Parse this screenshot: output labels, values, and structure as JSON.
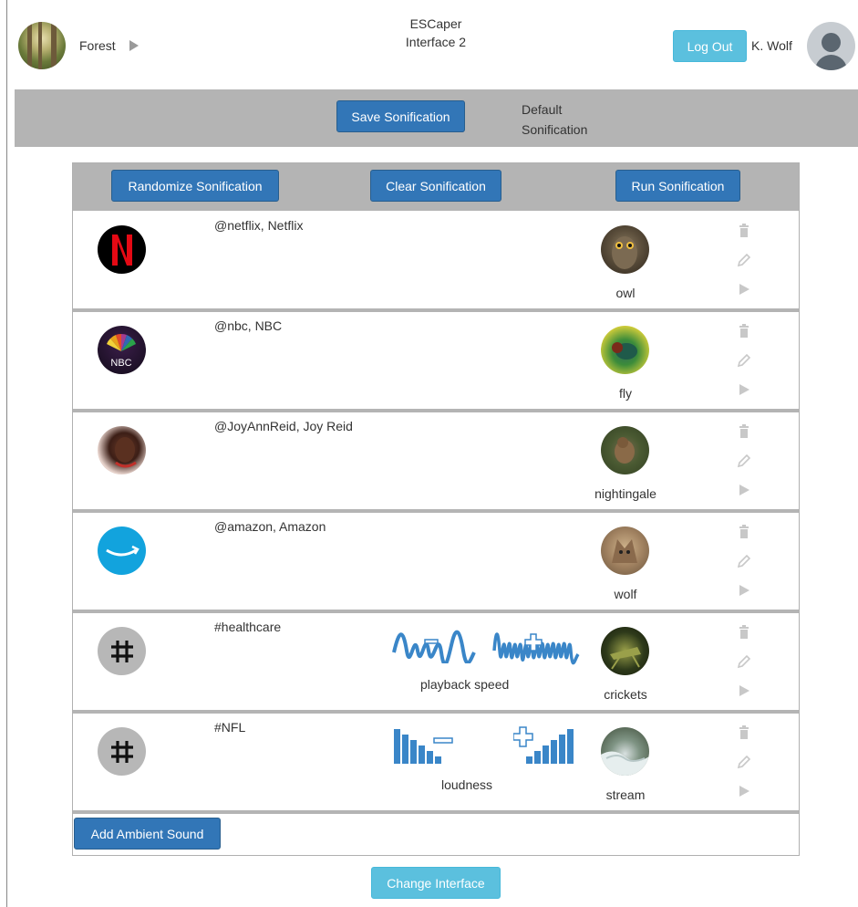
{
  "header": {
    "environment_name": "Forest",
    "app_title": "ESCaper",
    "app_subtitle": "Interface 2",
    "logout_label": "Log Out",
    "user_name": "K. Wolf"
  },
  "savebar": {
    "save_label": "Save Sonification",
    "current_line1": "Default",
    "current_line2": "Sonification"
  },
  "toolbar": {
    "randomize_label": "Randomize Sonification",
    "clear_label": "Clear Sonification",
    "run_label": "Run Sonification"
  },
  "rows": [
    {
      "source": "@netflix, Netflix",
      "source_icon": "netflix-logo",
      "sound": "owl"
    },
    {
      "source": "@nbc, NBC",
      "source_icon": "nbc-logo",
      "source_icon_text": "NBC",
      "sound": "fly"
    },
    {
      "source": "@JoyAnnReid, Joy Reid",
      "source_icon": "profile-photo",
      "sound": "nightingale"
    },
    {
      "source": "@amazon, Amazon",
      "source_icon": "amazon-logo",
      "sound": "wolf"
    },
    {
      "source": "#healthcare",
      "source_icon": "hashtag-icon",
      "sound": "crickets",
      "control_label": "playback speed"
    },
    {
      "source": "#NFL",
      "source_icon": "hashtag-icon",
      "sound": "stream",
      "control_label": "loudness"
    }
  ],
  "footer": {
    "add_label": "Add Ambient Sound",
    "change_label": "Change Interface"
  },
  "colors": {
    "primary": "#3276b7",
    "info": "#5bc0de",
    "bar_grey": "#b4b4b4",
    "wave_blue": "#3a86c8"
  }
}
